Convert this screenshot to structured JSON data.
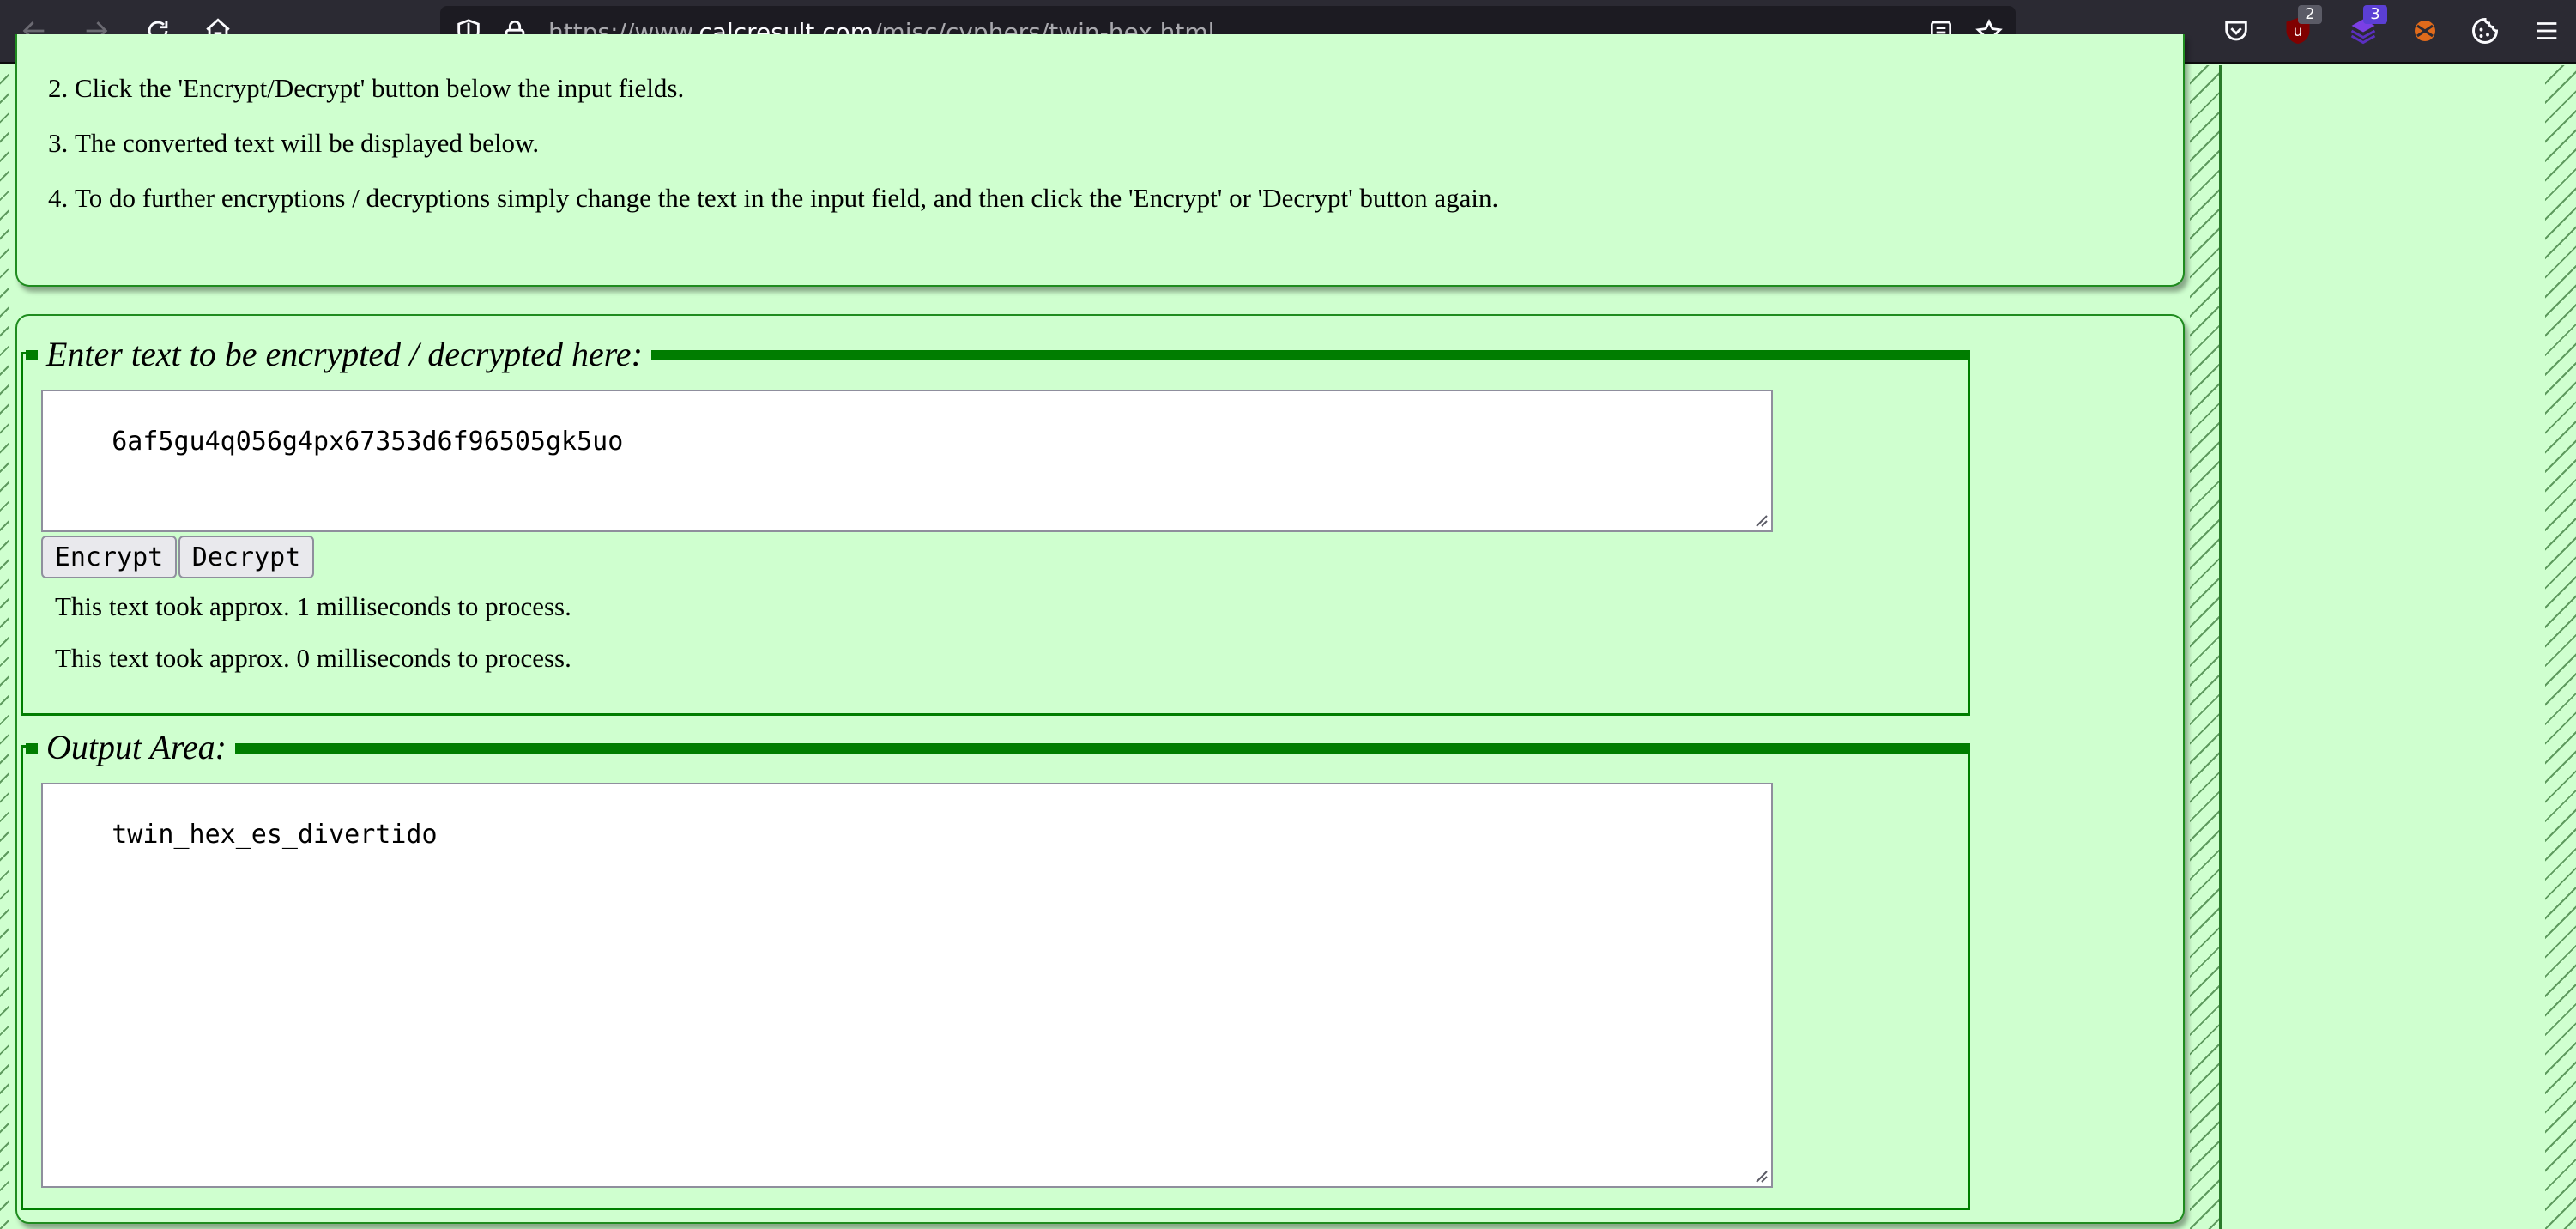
{
  "browser": {
    "url_prefix": "https://www.",
    "url_domain": "calcresult.com",
    "url_path": "/misc/cyphers/twin-hex.html",
    "icons": {
      "back": "back-arrow-icon",
      "forward": "forward-arrow-icon",
      "reload": "reload-icon",
      "home": "home-icon",
      "shield": "tracking-shield-icon",
      "lock": "lock-icon",
      "reader": "reader-view-icon",
      "bookmark": "bookmark-star-icon",
      "pocket": "pocket-icon",
      "ublock": "ublock-origin-icon",
      "ext2": "extension-icon",
      "ext3": "extension-icon",
      "cookie": "cookie-icon",
      "menu": "hamburger-menu-icon"
    },
    "ublock_badge": "2",
    "ext_badge": "3"
  },
  "instructions": {
    "items": [
      {
        "num": "2.",
        "text": "Click the 'Encrypt/Decrypt' button below the input fields."
      },
      {
        "num": "3.",
        "text": "The converted text will be displayed below."
      },
      {
        "num": "4.",
        "text": "To do further encryptions / decryptions simply change the text in the input field, and then click the 'Encrypt' or 'Decrypt' button again."
      }
    ]
  },
  "input_section": {
    "legend": "Enter text to be encrypted / decrypted here:",
    "value": "6af5gu4q056g4px67353d6f96505gk5uo",
    "encrypt_label": "Encrypt",
    "decrypt_label": "Decrypt",
    "timing_1": "This text took approx. 1 milliseconds to process.",
    "timing_2": "This text took approx. 0 milliseconds to process."
  },
  "output_section": {
    "legend": "Output Area:",
    "value": "twin_hex_es_divertido"
  },
  "colors": {
    "page_bg": "#cfffcf",
    "frame_green": "#007d00",
    "toolbar_bg": "#2b2a33"
  }
}
